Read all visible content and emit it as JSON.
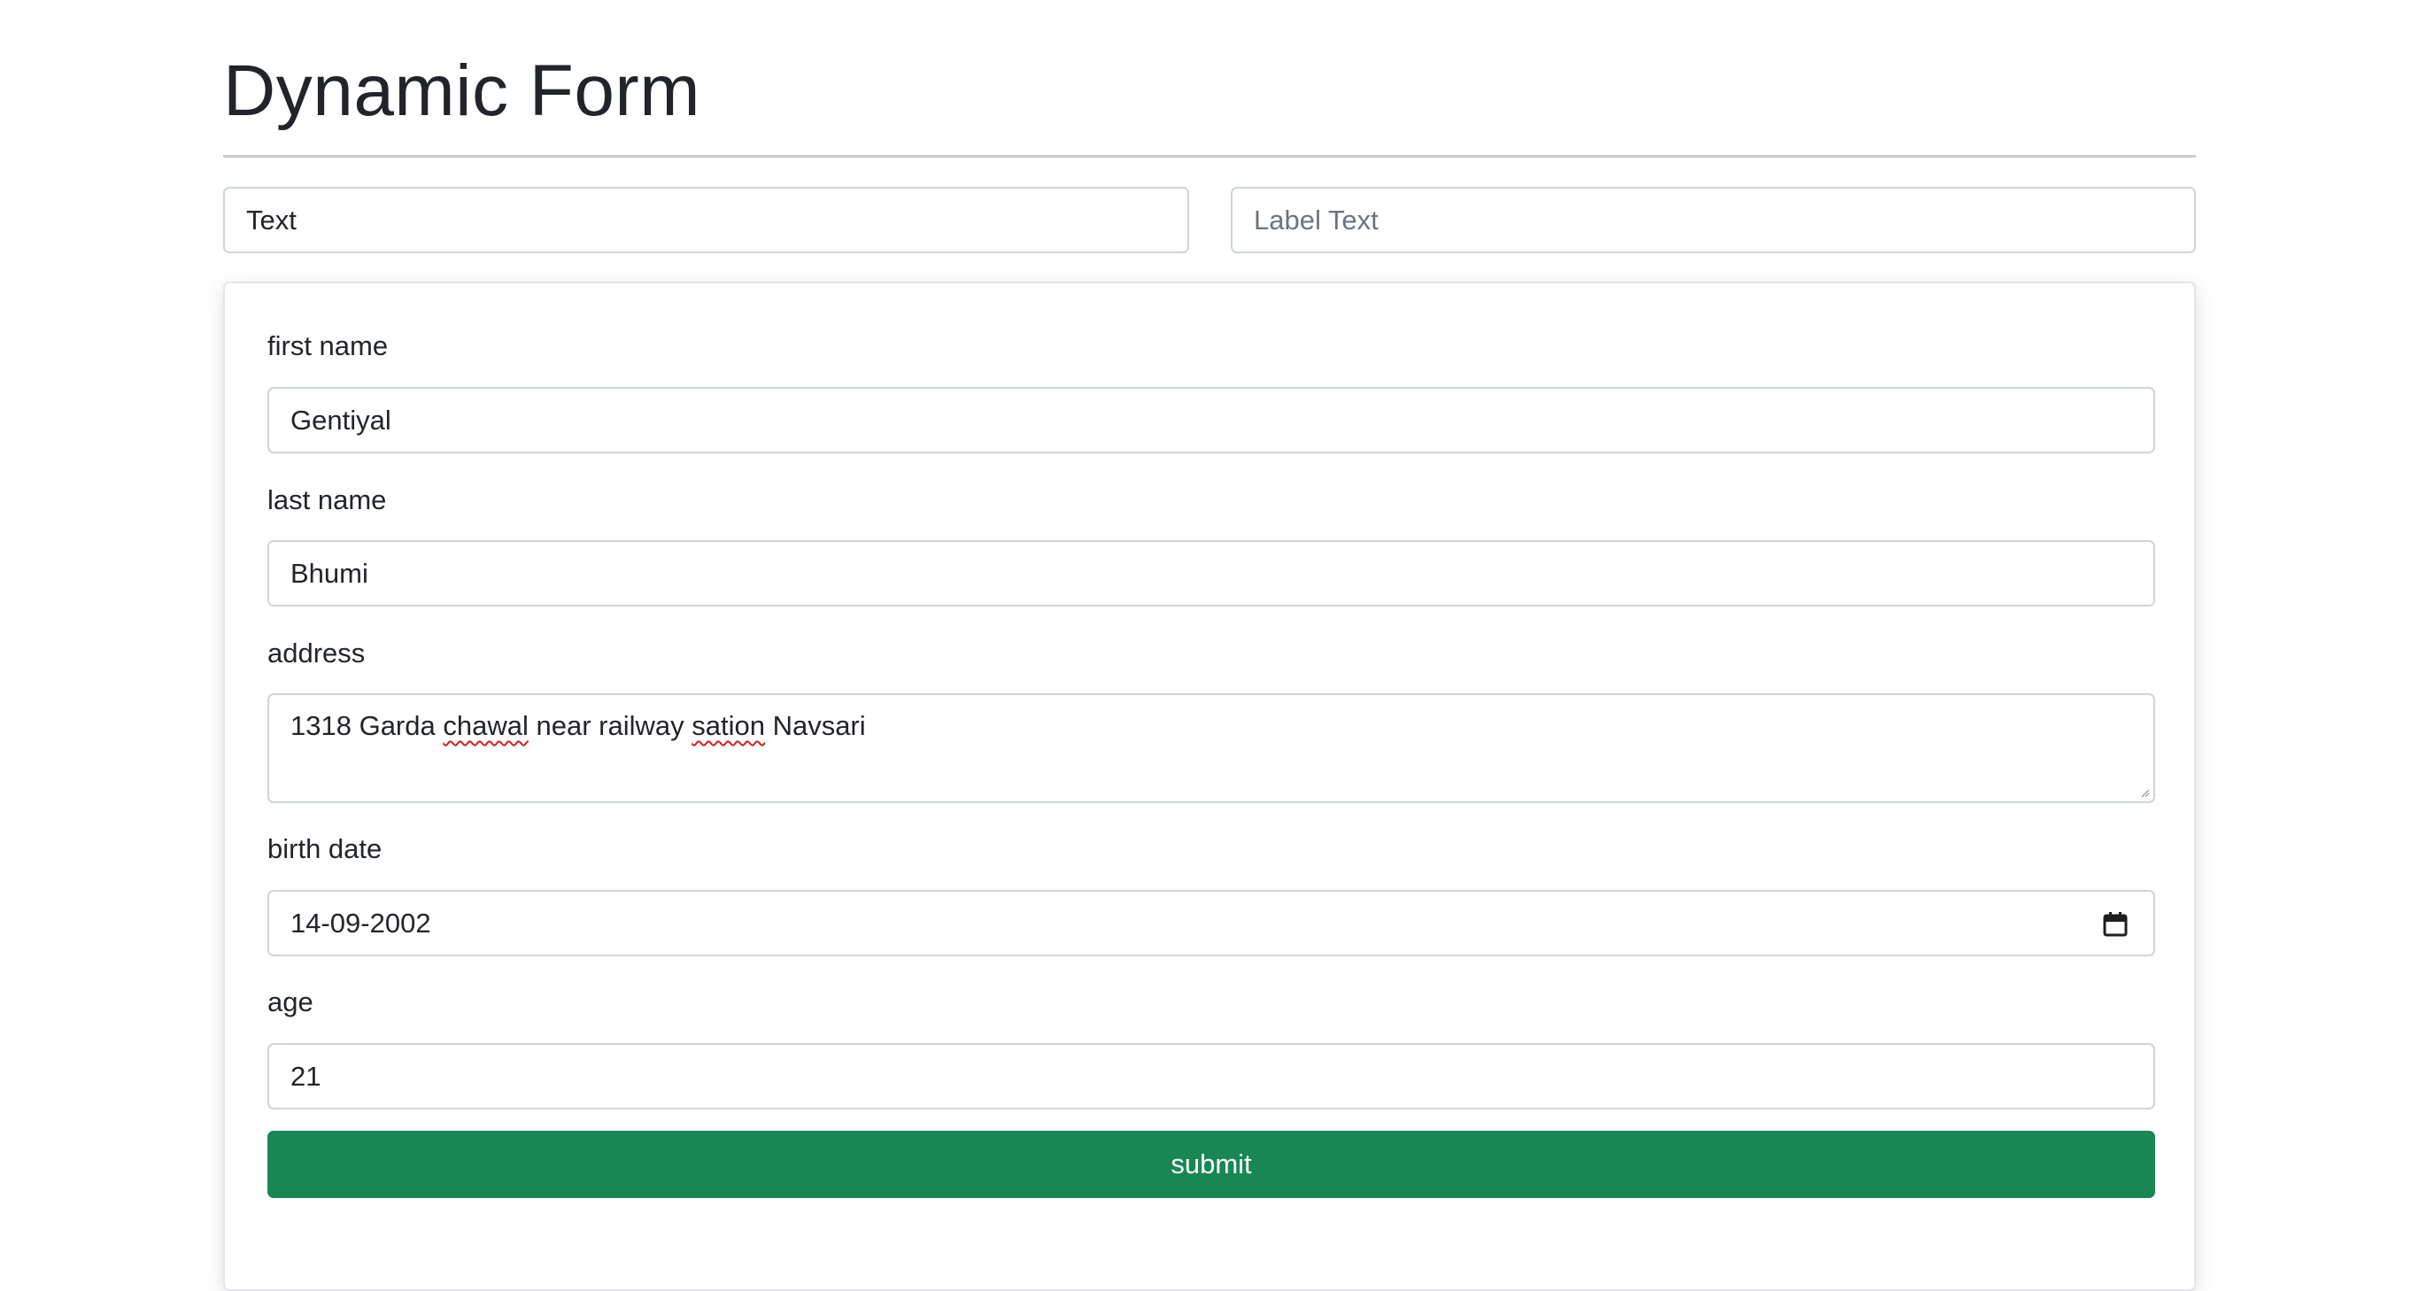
{
  "page": {
    "title": "Dynamic Form"
  },
  "builder": {
    "type_input_value": "Text",
    "label_input_placeholder": "Label Text"
  },
  "form": {
    "fields": [
      {
        "label": "first name",
        "value": "Gentiyal"
      },
      {
        "label": "last name",
        "value": "Bhumi"
      },
      {
        "label": "address",
        "value_parts": [
          "1318 Garda ",
          "chawal",
          " near railway ",
          "sation",
          " Navsari"
        ]
      },
      {
        "label": "birth date",
        "value": "14-09-2002",
        "icon": "calendar-icon"
      },
      {
        "label": "age",
        "value": "21"
      }
    ],
    "submit_label": "submit"
  },
  "colors": {
    "primary_button": "#198754",
    "spellcheck_underline": "#d21f1f"
  }
}
